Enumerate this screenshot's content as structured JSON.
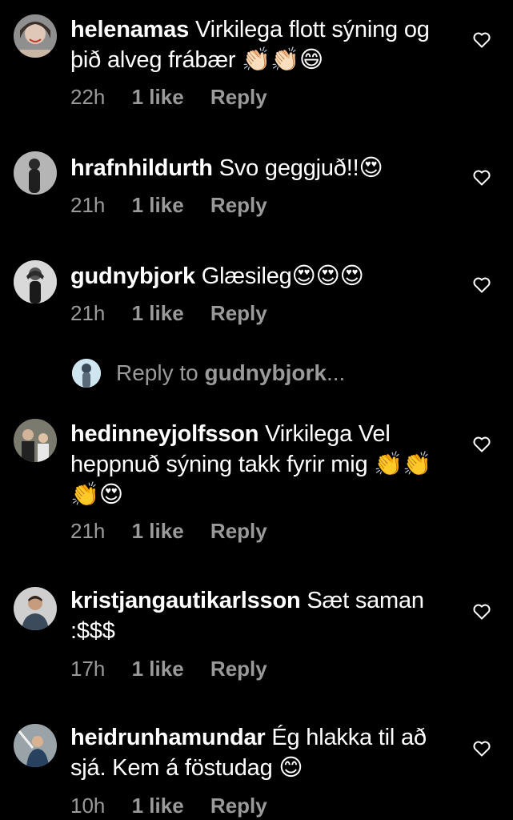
{
  "comments": [
    {
      "username": "helenamas",
      "text": "Virkilega flott sýning og þið alveg frábær 👏🏻👏🏻😄",
      "time": "22h",
      "likes": "1 like",
      "reply": "Reply"
    },
    {
      "username": "hrafnhildurth",
      "text": "Svo geggjuð!!😍",
      "time": "21h",
      "likes": "1 like",
      "reply": "Reply"
    },
    {
      "username": "gudnybjork",
      "text": "Glæsileg😍😍😍",
      "time": "21h",
      "likes": "1 like",
      "reply": "Reply"
    },
    {
      "username": "hedinneyjolfsson",
      "text": "Virkilega Vel heppnuð sýning takk fyrir mig 👏👏👏😍",
      "time": "21h",
      "likes": "1 like",
      "reply": "Reply"
    },
    {
      "username": "kristjangautikarlsson",
      "text": "Sæt saman :$$$",
      "time": "17h",
      "likes": "1 like",
      "reply": "Reply"
    },
    {
      "username": "heidrunhamundar",
      "text": "Ég hlakka til að sjá. Kem á föstudag 😊",
      "time": "10h",
      "likes": "1 like",
      "reply": "Reply"
    }
  ],
  "reply_thread": {
    "prefix": "Reply to",
    "username": "gudnybjork",
    "suffix": "..."
  },
  "icons": {
    "like": "heart-outline-icon"
  },
  "colors": {
    "background": "#000000",
    "text": "#ffffff",
    "secondary": "#9a9a9a"
  }
}
